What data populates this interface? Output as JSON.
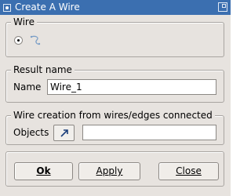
{
  "window": {
    "title": "Create A Wire"
  },
  "wire_group": {
    "title": "Wire"
  },
  "result_group": {
    "title": "Result name",
    "name_label": "Name",
    "name_value": "Wire_1"
  },
  "objects_group": {
    "title": "Wire creation from wires/edges connected",
    "objects_label": "Objects",
    "objects_value": ""
  },
  "buttons": {
    "ok": "Ok",
    "apply": "Apply",
    "close": "Close"
  }
}
